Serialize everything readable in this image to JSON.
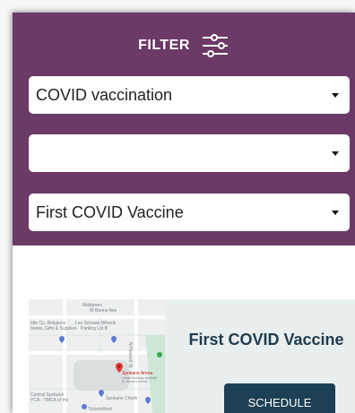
{
  "filter": {
    "title": "FILTER",
    "icon": "sliders-icon",
    "panel_color": "#6b3a66",
    "selects": [
      {
        "value": "COVID vaccination"
      },
      {
        "value": ""
      },
      {
        "value": "First COVID Vaccine"
      }
    ]
  },
  "location_card": {
    "title": "First COVID Vaccine",
    "schedule_label": "SCHEDULE",
    "map": {
      "labels": {
        "street1": "Mallgreen",
        "street2": "W Boone Ave",
        "poi1a": "Idle Co. Religious",
        "poi1b": "books, Gifts & Supplies",
        "poi2a": "Les Schwab Wheels",
        "poi2b": "Parking Lot B",
        "poi3a": "Spokane Arena",
        "poi3b": "Large hockey, football",
        "poi3c": "& concert venue",
        "poi4": "Spokane Chiefs",
        "poi5a": "Central Spokane",
        "poi5b": "YCA - YMCA of the",
        "poi6": "TicketsWest",
        "street3": "N Howard St"
      }
    }
  }
}
